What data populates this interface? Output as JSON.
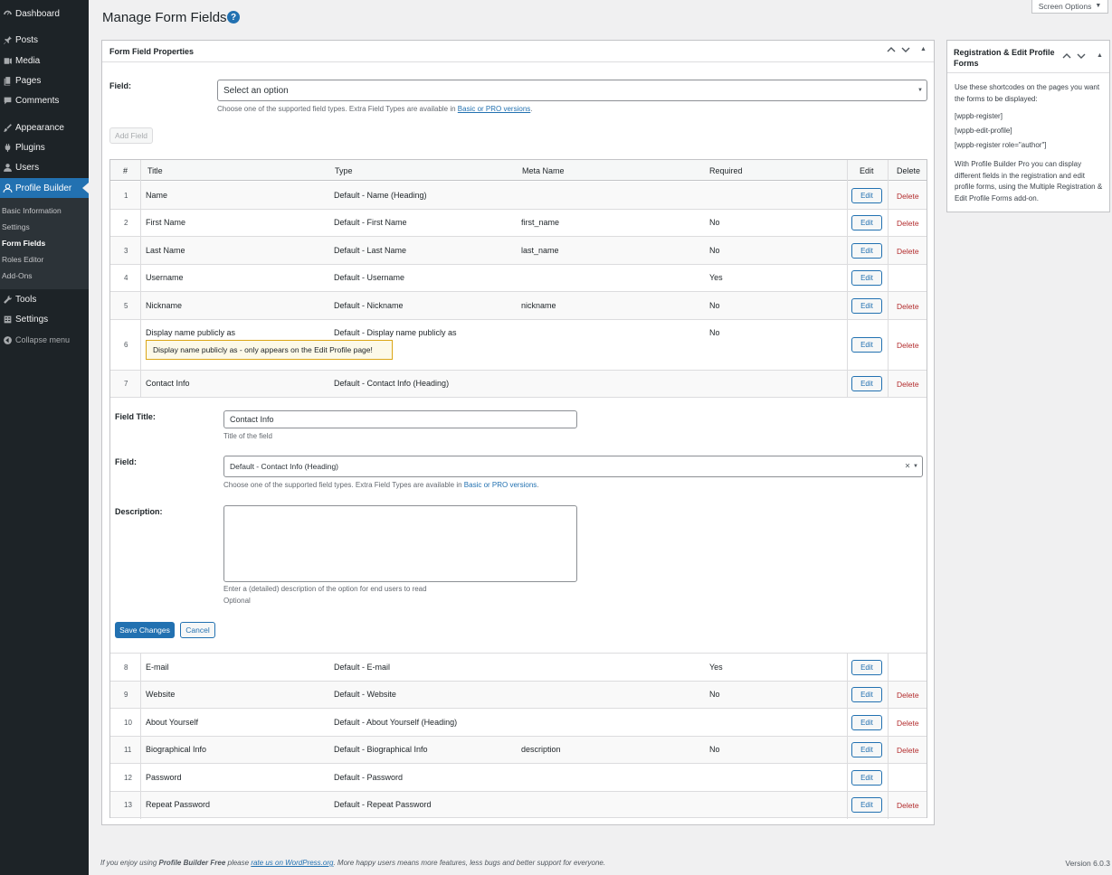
{
  "sidebar": {
    "items": [
      {
        "label": "Dashboard",
        "icon": "dashboard-icon"
      },
      {
        "label": "Posts",
        "icon": "pin-icon"
      },
      {
        "label": "Media",
        "icon": "media-icon"
      },
      {
        "label": "Pages",
        "icon": "page-icon"
      },
      {
        "label": "Comments",
        "icon": "comment-icon"
      },
      {
        "label": "Appearance",
        "icon": "brush-icon"
      },
      {
        "label": "Plugins",
        "icon": "plug-icon"
      },
      {
        "label": "Users",
        "icon": "user-icon"
      },
      {
        "label": "Profile Builder",
        "icon": "profile-icon"
      },
      {
        "label": "Tools",
        "icon": "wrench-icon"
      },
      {
        "label": "Settings",
        "icon": "settings-icon"
      },
      {
        "label": "Collapse menu",
        "icon": "collapse-icon"
      }
    ],
    "submenu": [
      "Basic Information",
      "Settings",
      "Form Fields",
      "Roles Editor",
      "Add-Ons"
    ]
  },
  "header": {
    "title": "Manage Form Fields",
    "help": "?",
    "screen_options": "Screen Options"
  },
  "main_box": {
    "title": "Form Field Properties",
    "field_label": "Field:",
    "select_placeholder": "Select an option",
    "help_prefix": "Choose one of the supported field types. Extra Field Types are available in ",
    "help_link": "Basic or PRO versions",
    "help_suffix": ".",
    "add_button": "Add Field"
  },
  "table": {
    "headers": [
      "#",
      "Title",
      "Type",
      "Meta Name",
      "Required",
      "Edit",
      "Delete"
    ],
    "edit_label": "Edit",
    "delete_label": "Delete",
    "rows": [
      {
        "num": "1",
        "title": "Name",
        "type": "Default - Name (Heading)",
        "meta": "",
        "required": ""
      },
      {
        "num": "2",
        "title": "First Name",
        "type": "Default - First Name",
        "meta": "first_name",
        "required": "No"
      },
      {
        "num": "3",
        "title": "Last Name",
        "type": "Default - Last Name",
        "meta": "last_name",
        "required": "No"
      },
      {
        "num": "4",
        "title": "Username",
        "type": "Default - Username",
        "meta": "",
        "required": "Yes"
      },
      {
        "num": "5",
        "title": "Nickname",
        "type": "Default - Nickname",
        "meta": "nickname",
        "required": "No"
      },
      {
        "num": "6",
        "title": "Display name publicly as",
        "type": "Default - Display name publicly as",
        "meta": "",
        "required": "No",
        "notice": "Display name publicly as - only appears on the Edit Profile page!"
      },
      {
        "num": "7",
        "title": "Contact Info",
        "type": "Default - Contact Info (Heading)",
        "meta": "",
        "required": ""
      },
      {
        "num": "8",
        "title": "E-mail",
        "type": "Default - E-mail",
        "meta": "",
        "required": "Yes"
      },
      {
        "num": "9",
        "title": "Website",
        "type": "Default - Website",
        "meta": "",
        "required": "No"
      },
      {
        "num": "10",
        "title": "About Yourself",
        "type": "Default - About Yourself (Heading)",
        "meta": "",
        "required": ""
      },
      {
        "num": "11",
        "title": "Biographical Info",
        "type": "Default - Biographical Info",
        "meta": "description",
        "required": "No"
      },
      {
        "num": "12",
        "title": "Password",
        "type": "Default - Password",
        "meta": "",
        "required": ""
      },
      {
        "num": "13",
        "title": "Repeat Password",
        "type": "Default - Repeat Password",
        "meta": "",
        "required": ""
      }
    ]
  },
  "edit_panel": {
    "title_label": "Field Title:",
    "title_value": "Contact Info",
    "title_help": "Title of the field",
    "field_label": "Field:",
    "field_value": "Default - Contact Info (Heading)",
    "clear": "×",
    "field_help_prefix": "Choose one of the supported field types. Extra Field Types are available in ",
    "field_help_link": "Basic or PRO versions",
    "field_help_suffix": ".",
    "description_label": "Description:",
    "description_value": "",
    "description_help": "Enter a (detailed) description of the option for end users to read",
    "description_optional": "Optional",
    "save_button": "Save Changes",
    "cancel_button": "Cancel"
  },
  "side_box": {
    "title": "Registration & Edit Profile Forms",
    "intro": "Use these shortcodes on the pages you want the forms to be displayed:",
    "shortcodes": [
      "[wppb-register]",
      "[wppb-edit-profile]",
      "[wppb-register role=\"author\"]"
    ],
    "pro_text": "With Profile Builder Pro you can display different fields in the registration and edit profile forms, using the Multiple Registration & Edit Profile Forms add-on."
  },
  "footer": {
    "prefix": "If you enjoy using ",
    "brand": "Profile Builder Free",
    "middle": " please ",
    "link": "rate us on WordPress.org",
    "suffix": ". More happy users means more features, less bugs and better support for everyone.",
    "version": "Version 6.0.3"
  },
  "colors": {
    "sidebar_bg": "#1d2327",
    "accent": "#2271b1",
    "delete_red": "#b32d2e",
    "notice_border": "#dba617"
  }
}
